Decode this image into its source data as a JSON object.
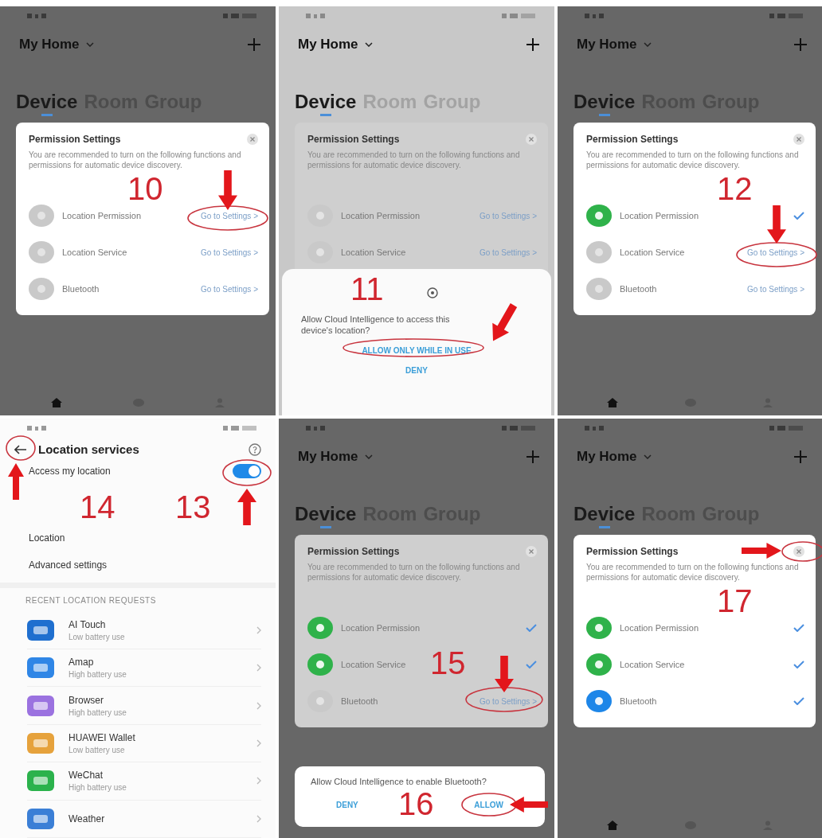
{
  "panels": [
    {
      "kind": "home",
      "light_scrim": false,
      "home_title": "My Home",
      "show_nav": true,
      "tabs": [
        {
          "label": "Device",
          "selected": true
        },
        {
          "label": "Room",
          "selected": false
        },
        {
          "label": "Group",
          "selected": false
        }
      ],
      "card": {
        "dimmed": false,
        "title": "Permission Settings",
        "description": "You are recommended to turn on the following functions and permissions for automatic device discovery.",
        "rows": [
          {
            "label": "Location Permission",
            "granted": false,
            "action": "Go to Settings >"
          },
          {
            "label": "Location Service",
            "granted": false,
            "action": "Go to Settings >"
          },
          {
            "label": "Bluetooth",
            "granted": false,
            "action": "Go to Settings >"
          }
        ]
      },
      "annotations": [
        {
          "label": "10"
        }
      ]
    },
    {
      "kind": "home",
      "light_scrim": true,
      "home_title": "My Home",
      "show_nav": false,
      "tabs": [
        {
          "label": "Device",
          "selected": true
        },
        {
          "label": "Room",
          "selected": false
        },
        {
          "label": "Group",
          "selected": false
        }
      ],
      "card": {
        "dimmed": true,
        "title": "Permission Settings",
        "description": "You are recommended to turn on the following functions and permissions for automatic device discovery.",
        "rows": [
          {
            "label": "Location Permission",
            "granted": false,
            "action": "Go to Settings >"
          },
          {
            "label": "Location Service",
            "granted": false,
            "action": "Go to Settings >"
          }
        ]
      },
      "dialog": {
        "kind": "sheet",
        "text": "Allow Cloud Intelligence to access this device's location?",
        "buttons": [
          {
            "label": "ALLOW ONLY WHILE IN USE"
          },
          {
            "label": "DENY"
          }
        ]
      },
      "annotations": [
        {
          "label": "11"
        }
      ]
    },
    {
      "kind": "home",
      "light_scrim": false,
      "home_title": "My Home",
      "show_nav": true,
      "tabs": [
        {
          "label": "Device",
          "selected": true
        },
        {
          "label": "Room",
          "selected": false
        },
        {
          "label": "Group",
          "selected": false
        }
      ],
      "card": {
        "dimmed": false,
        "title": "Permission Settings",
        "description": "You are recommended to turn on the following functions and permissions for automatic device discovery.",
        "rows": [
          {
            "label": "Location Permission",
            "granted": true,
            "color": "#2fb24a"
          },
          {
            "label": "Location Service",
            "granted": false,
            "action": "Go to Settings >"
          },
          {
            "label": "Bluetooth",
            "granted": false,
            "action": "Go to Settings >"
          }
        ]
      },
      "annotations": [
        {
          "label": "12"
        }
      ]
    },
    {
      "kind": "settings",
      "title": "Location services",
      "toggle": {
        "label": "Access my location",
        "on": true
      },
      "links": [
        {
          "label": "Location"
        },
        {
          "label": "Advanced settings"
        }
      ],
      "section": "RECENT LOCATION REQUESTS",
      "apps": [
        {
          "name": "AI Touch",
          "usage": "Low battery use",
          "color": "#1f6fcf"
        },
        {
          "name": "Amap",
          "usage": "High battery use",
          "color": "#2f86e6"
        },
        {
          "name": "Browser",
          "usage": "High battery use",
          "color": "#9b72e0"
        },
        {
          "name": "HUAWEI Wallet",
          "usage": "Low battery use",
          "color": "#e6a23c"
        },
        {
          "name": "WeChat",
          "usage": "High battery use",
          "color": "#2bb24c"
        },
        {
          "name": "Weather",
          "color": "#3b7fd6"
        }
      ],
      "annotations": [
        {
          "label": "14"
        },
        {
          "label": "13"
        }
      ]
    },
    {
      "kind": "home",
      "light_scrim": false,
      "home_title": "My Home",
      "show_nav": false,
      "tabs": [
        {
          "label": "Device",
          "selected": true
        },
        {
          "label": "Room",
          "selected": false
        },
        {
          "label": "Group",
          "selected": false
        }
      ],
      "card": {
        "dimmed": true,
        "title": "Permission Settings",
        "description": "You are recommended to turn on the following functions and permissions for automatic device discovery.",
        "rows": [
          {
            "label": "Location Permission",
            "granted": true,
            "color": "#2fb24a"
          },
          {
            "label": "Location Service",
            "granted": true,
            "color": "#2fb24a"
          },
          {
            "label": "Bluetooth",
            "granted": false,
            "action": "Go to Settings >"
          }
        ]
      },
      "dialog": {
        "kind": "popup",
        "text": "Allow Cloud Intelligence to enable Bluetooth?",
        "buttons": [
          {
            "label": "DENY"
          },
          {
            "label": "ALLOW"
          }
        ]
      },
      "annotations": [
        {
          "label": "15"
        },
        {
          "label": "16"
        }
      ]
    },
    {
      "kind": "home",
      "light_scrim": false,
      "home_title": "My Home",
      "show_nav": true,
      "tabs": [
        {
          "label": "Device",
          "selected": true
        },
        {
          "label": "Room",
          "selected": false
        },
        {
          "label": "Group",
          "selected": false
        }
      ],
      "card": {
        "dimmed": false,
        "title": "Permission Settings",
        "description": "You are recommended to turn on the following functions and permissions for automatic device discovery.",
        "rows": [
          {
            "label": "Location Permission",
            "granted": true,
            "color": "#2fb24a"
          },
          {
            "label": "Location Service",
            "granted": true,
            "color": "#2fb24a"
          },
          {
            "label": "Bluetooth",
            "granted": true,
            "color": "#1d86e8"
          }
        ]
      },
      "annotations": [
        {
          "label": "17"
        }
      ]
    }
  ]
}
